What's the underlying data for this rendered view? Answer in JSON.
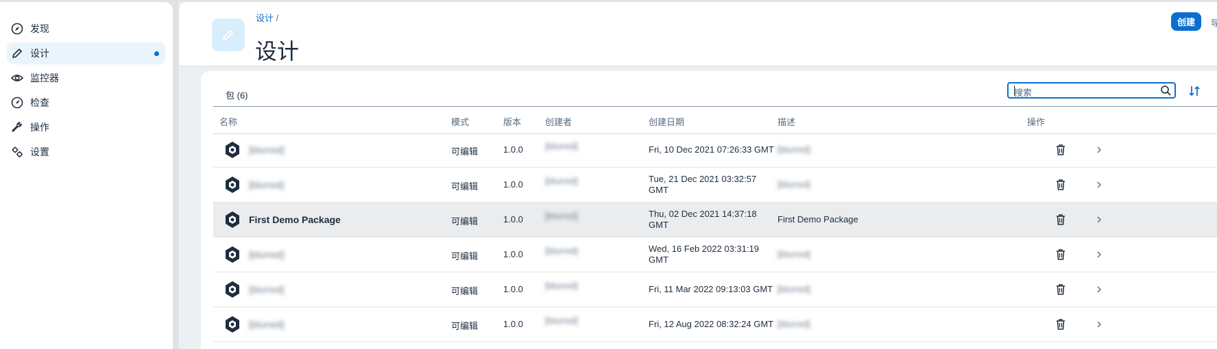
{
  "sidebar": {
    "items": [
      {
        "label": "发现",
        "icon": "compass-icon"
      },
      {
        "label": "设计",
        "icon": "pencil-icon",
        "active": true
      },
      {
        "label": "监控器",
        "icon": "eye-icon"
      },
      {
        "label": "检查",
        "icon": "gauge-icon"
      },
      {
        "label": "操作",
        "icon": "wrench-icon"
      },
      {
        "label": "设置",
        "icon": "gears-icon"
      }
    ]
  },
  "header": {
    "breadcrumb": "设计",
    "breadcrumb_sep": "/",
    "title": "设计",
    "create_label": "创建",
    "cut_label": "导"
  },
  "table": {
    "title": "包 (6)",
    "search_placeholder": "搜索",
    "columns": [
      "名称",
      "模式",
      "版本",
      "创建者",
      "创建日期",
      "描述",
      "操作"
    ],
    "rows": [
      {
        "name": "[blurred]",
        "mode": "可编辑",
        "version": "1.0.0",
        "creator": "[blurred]",
        "date1": "Fri, 10 Dec 2021 07:26:33 GMT",
        "date2": "",
        "desc": "[blurred]"
      },
      {
        "name": "[blurred]",
        "mode": "可编辑",
        "version": "1.0.0",
        "creator": "[blurred]",
        "date1": "Tue, 21 Dec 2021 03:32:57",
        "date2": "GMT",
        "desc": "[blurred]"
      },
      {
        "name": "First Demo Package",
        "mode": "可编辑",
        "version": "1.0.0",
        "creator": "[blurred]",
        "date1": "Thu, 02 Dec 2021 14:37:18",
        "date2": "GMT",
        "desc": "First Demo Package",
        "selected": true
      },
      {
        "name": "[blurred]",
        "mode": "可编辑",
        "version": "1.0.0",
        "creator": "[blurred]",
        "date1": "Wed, 16 Feb 2022 03:31:19",
        "date2": "GMT",
        "desc": "[blurred]"
      },
      {
        "name": "[blurred]",
        "mode": "可编辑",
        "version": "1.0.0",
        "creator": "[blurred]",
        "date1": "Fri, 11 Mar 2022 09:13:03 GMT",
        "date2": "",
        "desc": "[blurred]"
      },
      {
        "name": "[blurred]",
        "mode": "可编辑",
        "version": "1.0.0",
        "creator": "[blurred]",
        "date1": "Fri, 12 Aug 2022 08:32:24 GMT",
        "date2": "",
        "desc": "[blurred]"
      }
    ]
  },
  "colors": {
    "accent": "#0a6ed1",
    "selected_row": "#eaecee",
    "active_nav": "#eaf4fb"
  }
}
